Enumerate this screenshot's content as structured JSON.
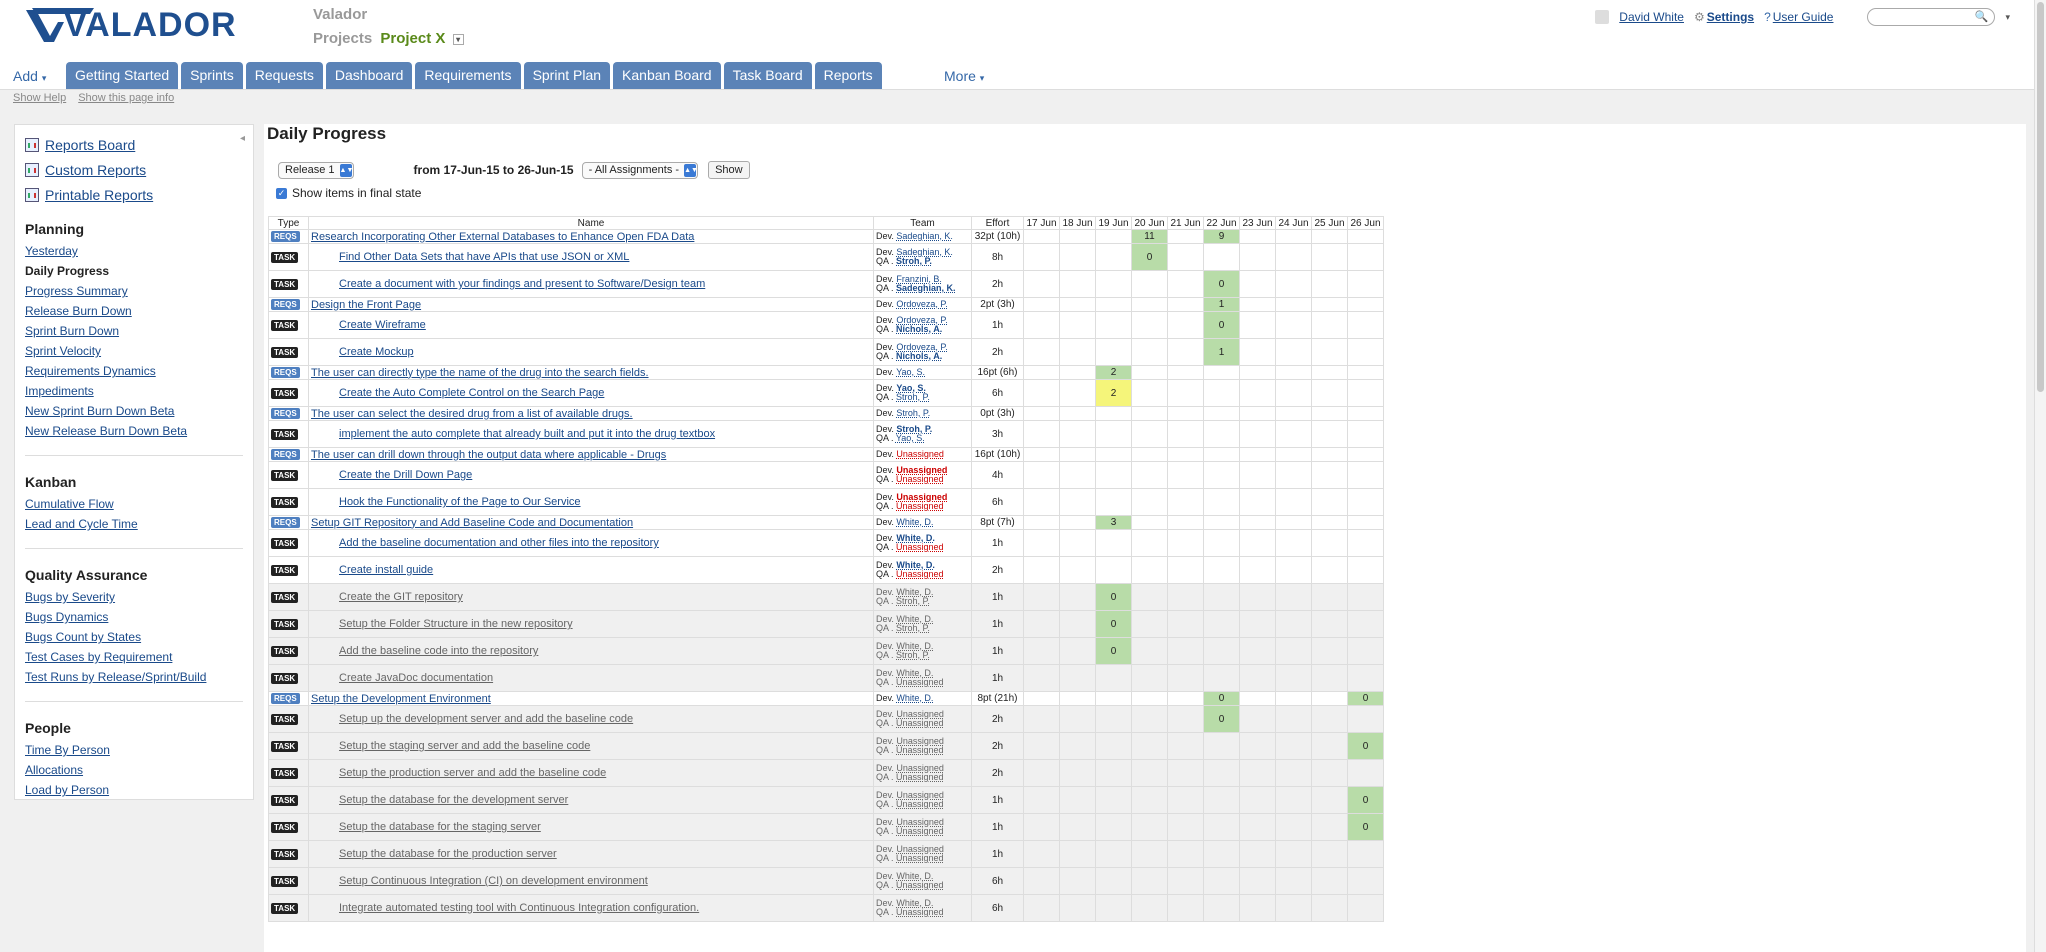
{
  "brand": {
    "logo_text": "VALADOR",
    "app_name": "Valador",
    "projects_label": "Projects",
    "project_name": "Project X"
  },
  "user": {
    "name": "David White",
    "settings": "Settings",
    "guide": "User Guide"
  },
  "nav": {
    "add": "Add",
    "tabs": [
      "Getting Started",
      "Sprints",
      "Requests",
      "Dashboard",
      "Requirements",
      "Sprint Plan",
      "Kanban Board",
      "Task Board",
      "Reports"
    ],
    "more": "More"
  },
  "sub": {
    "help": "Show Help",
    "info": "Show this page info"
  },
  "sidebar": {
    "top": [
      "Reports Board",
      "Custom Reports",
      "Printable Reports"
    ],
    "sections": [
      {
        "title": "Planning",
        "items": [
          "Yesterday",
          "Daily Progress",
          "Progress Summary",
          "Release Burn Down",
          "Sprint Burn Down",
          "Sprint Velocity",
          "Requirements Dynamics",
          "Impediments",
          "New Sprint Burn Down Beta",
          "New Release Burn Down Beta"
        ],
        "active": "Daily Progress"
      },
      {
        "title": "Kanban",
        "items": [
          "Cumulative Flow",
          "Lead and Cycle Time"
        ]
      },
      {
        "title": "Quality Assurance",
        "items": [
          "Bugs by Severity",
          "Bugs Dynamics",
          "Bugs Count by States",
          "Test Cases by Requirement",
          "Test Runs by Release/Sprint/Build"
        ]
      },
      {
        "title": "People",
        "items": [
          "Time By Person",
          "Allocations",
          "Load by Person"
        ]
      }
    ]
  },
  "page": {
    "title": "Daily Progress",
    "release": "Release 1",
    "range": "from 17-Jun-15 to 26-Jun-15",
    "assignments": "- All Assignments -",
    "show_btn": "Show",
    "final_state": "Show items in final state"
  },
  "table": {
    "headers": [
      "Type",
      "Name",
      "Team",
      "Effort",
      "17 Jun",
      "18 Jun",
      "19 Jun",
      "20 Jun",
      "21 Jun",
      "22 Jun",
      "23 Jun",
      "24 Jun",
      "25 Jun",
      "26 Jun"
    ],
    "rows": [
      {
        "type": "REQS",
        "name": "Research Incorporating Other External Databases to Enhance Open FDA Data",
        "dev": "Sadeghian, K.",
        "qa": null,
        "effort": "32pt (10h)",
        "days": {
          "20 Jun": "11",
          "22 Jun": "9"
        }
      },
      {
        "type": "TASK",
        "name": "Find Other Data Sets that have APIs that use JSON or XML",
        "dev": "Sadeghian, K.",
        "qa": "Stroh, P.",
        "qab": true,
        "effort": "8h",
        "days": {
          "20 Jun": "0"
        }
      },
      {
        "type": "TASK",
        "name": "Create a document with your findings and present to Software/Design team",
        "dev": "Franzini, B.",
        "qa": "Sadeghian, K.",
        "qab": true,
        "effort": "2h",
        "days": {
          "22 Jun": "0"
        }
      },
      {
        "type": "REQS",
        "name": "Design the Front Page",
        "dev": "Ordoveza, P.",
        "qa": null,
        "effort": "2pt (3h)",
        "days": {
          "22 Jun": "1"
        }
      },
      {
        "type": "TASK",
        "name": "Create Wireframe",
        "dev": "Ordoveza, P.",
        "qa": "Nichols, A.",
        "qab": true,
        "effort": "1h",
        "days": {
          "22 Jun": "0"
        }
      },
      {
        "type": "TASK",
        "name": "Create Mockup",
        "dev": "Ordoveza, P.",
        "qa": "Nichols, A.",
        "qab": true,
        "effort": "2h",
        "days": {
          "22 Jun": "1"
        }
      },
      {
        "type": "REQS",
        "name": "The user can directly type the name of the drug into the search fields.",
        "dev": "Yao, S.",
        "qa": null,
        "effort": "16pt (6h)",
        "days": {
          "19 Jun": "2"
        }
      },
      {
        "type": "TASK",
        "name": "Create the Auto Complete Control on the Search Page",
        "dev": "Yao, S.",
        "devb": true,
        "qa": "Stroh, P.",
        "effort": "6h",
        "days": {
          "19 Jun": "2"
        },
        "yellow": "19 Jun"
      },
      {
        "type": "REQS",
        "name": "The user can select the desired drug from a list of available drugs.",
        "dev": "Stroh, P.",
        "qa": null,
        "effort": "0pt (3h)",
        "days": {}
      },
      {
        "type": "TASK",
        "name": "implement the auto complete that already built and put it into the drug textbox",
        "dev": "Stroh, P.",
        "devb": true,
        "qa": "Yao, S.",
        "effort": "3h",
        "days": {}
      },
      {
        "type": "REQS",
        "name": "The user can drill down through the output data where applicable - Drugs",
        "dev": "Unassigned",
        "devu": true,
        "qa": null,
        "effort": "16pt (10h)",
        "days": {}
      },
      {
        "type": "TASK",
        "name": "Create the Drill Down Page",
        "dev": "Unassigned",
        "devu": true,
        "devb": true,
        "qa": "Unassigned",
        "qau": true,
        "effort": "4h",
        "days": {}
      },
      {
        "type": "TASK",
        "name": "Hook the Functionality of the Page to Our Service",
        "dev": "Unassigned",
        "devu": true,
        "devb": true,
        "qa": "Unassigned",
        "qau": true,
        "effort": "6h",
        "days": {}
      },
      {
        "type": "REQS",
        "name": "Setup GIT Repository and Add Baseline Code and Documentation",
        "dev": "White, D.",
        "qa": null,
        "effort": "8pt (7h)",
        "days": {
          "19 Jun": "3"
        }
      },
      {
        "type": "TASK",
        "name": "Add the baseline documentation and other files into the repository",
        "dev": "White, D.",
        "devb": true,
        "qa": "Unassigned",
        "qau": true,
        "effort": "1h",
        "days": {}
      },
      {
        "type": "TASK",
        "name": "Create install guide",
        "dev": "White, D.",
        "devb": true,
        "qa": "Unassigned",
        "qau": true,
        "effort": "2h",
        "days": {}
      },
      {
        "type": "TASK",
        "name": "Create the GIT repository",
        "dev": "White, D.",
        "qa": "Stroh, P.",
        "final": true,
        "effort": "1h",
        "days": {
          "19 Jun": "0"
        }
      },
      {
        "type": "TASK",
        "name": "Setup the Folder Structure in the new repository",
        "dev": "White, D.",
        "qa": "Stroh, P.",
        "final": true,
        "effort": "1h",
        "days": {
          "19 Jun": "0"
        }
      },
      {
        "type": "TASK",
        "name": "Add the baseline code into the repository",
        "dev": "White, D.",
        "qa": "Stroh, P.",
        "final": true,
        "effort": "1h",
        "days": {
          "19 Jun": "0"
        }
      },
      {
        "type": "TASK",
        "name": "Create JavaDoc documentation",
        "dev": "White, D.",
        "qa": "Unassigned",
        "qau": true,
        "final": true,
        "effort": "1h",
        "days": {}
      },
      {
        "type": "REQS",
        "name": "Setup the Development Environment",
        "dev": "White, D.",
        "qa": null,
        "effort": "8pt (21h)",
        "days": {
          "22 Jun": "0",
          "26 Jun": "0"
        }
      },
      {
        "type": "TASK",
        "name": "Setup up the development server and add the baseline code",
        "dev": "Unassigned",
        "devu": true,
        "qa": "Unassigned",
        "qau": true,
        "final": true,
        "effort": "2h",
        "days": {
          "22 Jun": "0"
        }
      },
      {
        "type": "TASK",
        "name": "Setup the staging server and add the baseline code",
        "dev": "Unassigned",
        "devu": true,
        "qa": "Unassigned",
        "qau": true,
        "final": true,
        "effort": "2h",
        "days": {
          "26 Jun": "0"
        }
      },
      {
        "type": "TASK",
        "name": "Setup the production server and add the baseline code",
        "dev": "Unassigned",
        "devu": true,
        "qa": "Unassigned",
        "qau": true,
        "final": true,
        "effort": "2h",
        "days": {}
      },
      {
        "type": "TASK",
        "name": "Setup the database for the development server",
        "dev": "Unassigned",
        "devu": true,
        "qa": "Unassigned",
        "qau": true,
        "final": true,
        "effort": "1h",
        "days": {
          "26 Jun": "0"
        }
      },
      {
        "type": "TASK",
        "name": "Setup the database for the staging server",
        "dev": "Unassigned",
        "devu": true,
        "qa": "Unassigned",
        "qau": true,
        "final": true,
        "effort": "1h",
        "days": {
          "26 Jun": "0"
        }
      },
      {
        "type": "TASK",
        "name": "Setup the database for the production server",
        "dev": "Unassigned",
        "devu": true,
        "qa": "Unassigned",
        "qau": true,
        "final": true,
        "effort": "1h",
        "days": {}
      },
      {
        "type": "TASK",
        "name": "Setup Continuous Integration (CI) on development environment",
        "dev": "White, D.",
        "qa": "Unassigned",
        "qau": true,
        "final": true,
        "effort": "6h",
        "days": {}
      },
      {
        "type": "TASK",
        "name": "Integrate automated testing tool with Continuous Integration configuration.",
        "dev": "White, D.",
        "qa": "Unassigned",
        "qau": true,
        "final": true,
        "effort": "6h",
        "days": {}
      }
    ]
  },
  "labels": {
    "dev": "Dev.",
    "qa": "QA ."
  }
}
